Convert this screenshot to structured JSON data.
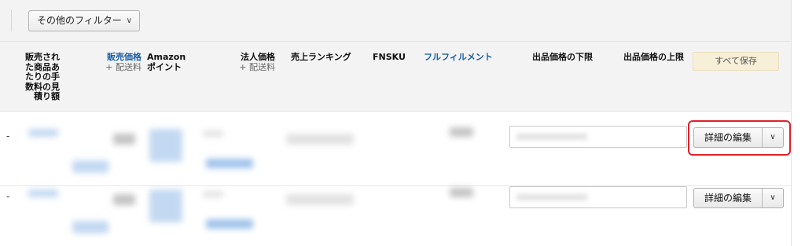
{
  "filter": {
    "label": "その他のフィルター"
  },
  "header": {
    "fee_estimate": "販売された商品あたりの手数料の見積り額",
    "fee_lines": [
      "販売され",
      "た商品あ",
      "たりの手",
      "数料の見",
      "積り額"
    ],
    "price": "販売価格",
    "price_sub": "+ 配送料",
    "points_lines": [
      "Amazon",
      "ポイント"
    ],
    "business_price": "法人価格",
    "business_sub": "+ 配送料",
    "sales_rank": "売上ランキング",
    "fnsku": "FNSKU",
    "fulfillment": "フルフィルメント",
    "min_price": "出品価格の下限",
    "max_price": "出品価格の上限",
    "save_all": "すべて保存"
  },
  "rows": [
    {
      "dash": "-",
      "edit_label": "詳細の編集"
    },
    {
      "dash": "-",
      "edit_label": "詳細の編集"
    }
  ],
  "colors": {
    "link": "#1a5fa8",
    "highlight": "#e0202a",
    "save_bg": "#f7efd8"
  }
}
